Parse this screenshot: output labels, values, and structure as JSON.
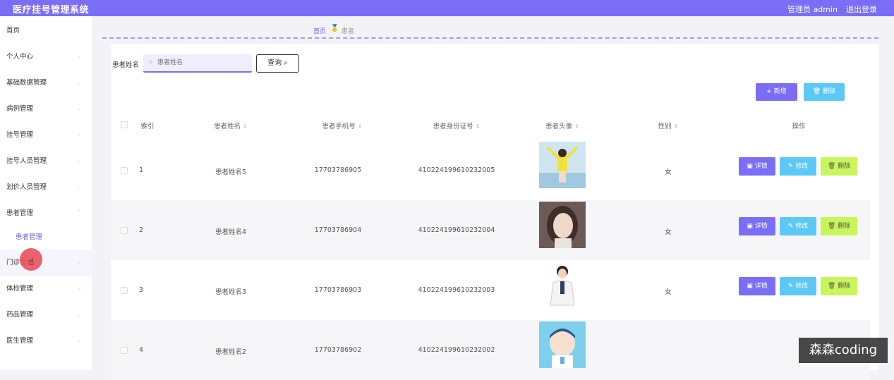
{
  "app": {
    "title": "医疗挂号管理系统",
    "user": "管理员 admin",
    "logout": "退出登录"
  },
  "sidebar": {
    "items": [
      {
        "label": "首页"
      },
      {
        "label": "个人中心"
      },
      {
        "label": "基础数据管理"
      },
      {
        "label": "病例管理"
      },
      {
        "label": "挂号管理"
      },
      {
        "label": "挂号人员管理"
      },
      {
        "label": "划价人员管理"
      },
      {
        "label": "患者管理"
      },
      {
        "label": "患者管理"
      },
      {
        "label": "门诊管理"
      },
      {
        "label": "体检管理"
      },
      {
        "label": "药品管理"
      },
      {
        "label": "医生管理"
      }
    ]
  },
  "breadcrumb": {
    "home": "首页",
    "current": "患者"
  },
  "search": {
    "label": "患者姓名",
    "placeholder": "患者姓名",
    "button": "查询"
  },
  "actions": {
    "add": "+ 新增",
    "delete": "删除"
  },
  "table": {
    "headers": {
      "index": "索引",
      "name": "患者姓名",
      "phone": "患者手机号",
      "id_card": "患者身份证号",
      "avatar": "患者头像",
      "gender": "性别",
      "ops": "操作"
    },
    "rows": [
      {
        "index": "1",
        "name": "患者姓名5",
        "phone": "17703786905",
        "id_card": "410224199610232005",
        "gender": "女"
      },
      {
        "index": "2",
        "name": "患者姓名4",
        "phone": "17703786904",
        "id_card": "410224199610232004",
        "gender": "女"
      },
      {
        "index": "3",
        "name": "患者姓名3",
        "phone": "17703786903",
        "id_card": "410224199610232003",
        "gender": "女"
      },
      {
        "index": "4",
        "name": "患者姓名2",
        "phone": "17703786902",
        "id_card": "410224199610232002",
        "gender": ""
      }
    ],
    "row_actions": {
      "detail": "详情",
      "edit": "修改",
      "remove": "删除"
    }
  },
  "watermark": "森森coding",
  "colors": {
    "primary": "#7b6ef6",
    "info": "#5bc8f5",
    "lime": "#c8f55b"
  }
}
